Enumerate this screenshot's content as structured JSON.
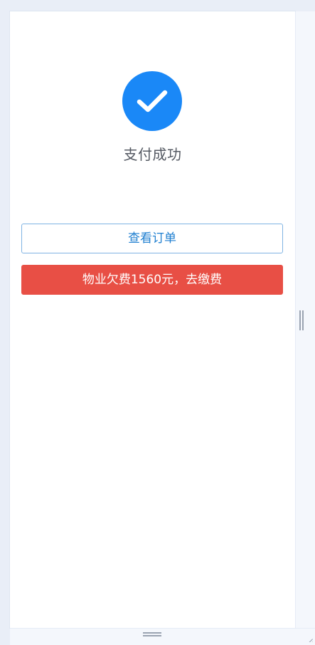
{
  "result": {
    "icon": "check-circle-icon",
    "title": "支付成功",
    "accent_color": "#1a88f7"
  },
  "actions": {
    "view_order_label": "查看订单",
    "pay_fee_label": "物业欠费1560元，去缴费",
    "pay_fee_color": "#e84f45",
    "view_order_color": "#1f7fd0"
  }
}
